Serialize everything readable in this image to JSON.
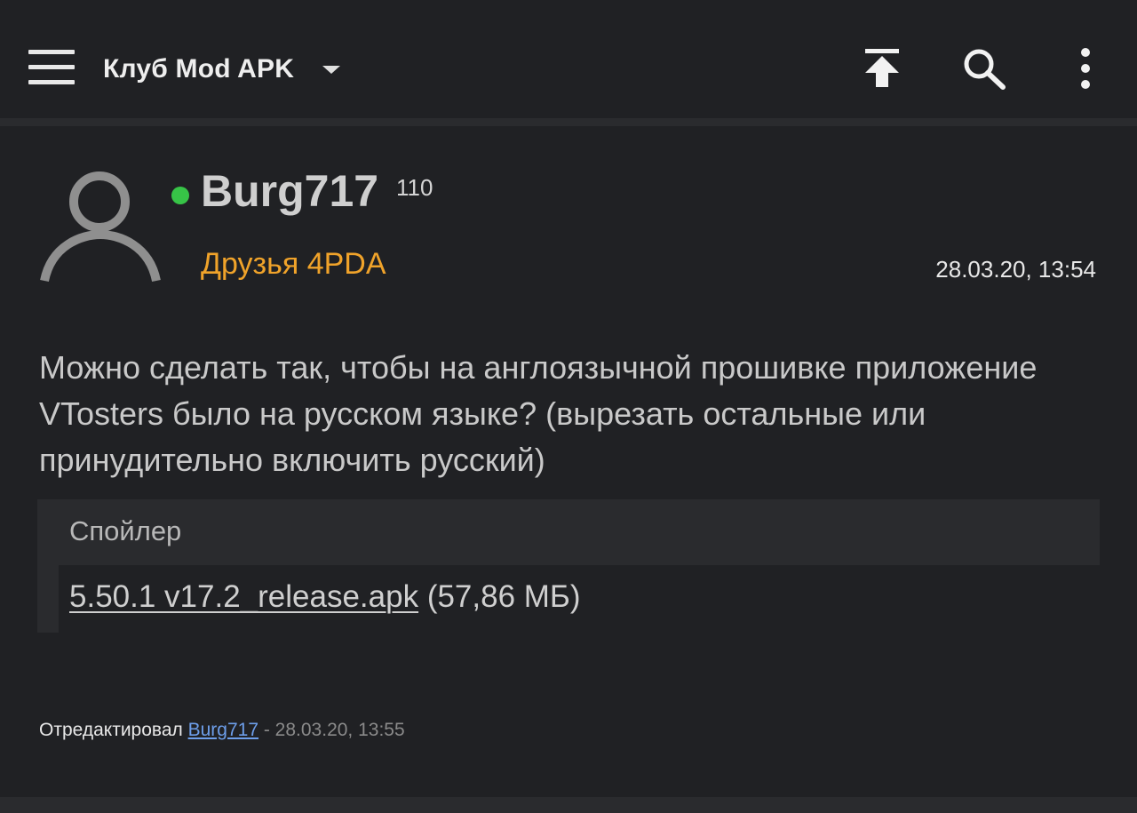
{
  "header": {
    "title": "Клуб Mod APK",
    "icons": [
      "menu-icon",
      "chevron-down-icon",
      "scroll-top-icon",
      "search-icon",
      "more-vert-icon"
    ]
  },
  "post": {
    "author": {
      "name": "Burg717",
      "reputation": "110",
      "group": "Друзья 4PDA",
      "online": true
    },
    "date": "28.03.20, 13:54",
    "body": "Можно сделать так, чтобы на англоязычной прошивке приложение VTosters было на русском языке? (вырезать остальные или принудительно включить русский)",
    "spoiler": {
      "title": "Спойлер",
      "attachment_name": "5.50.1 v17.2_release.apk",
      "attachment_size": "(57,86 МБ)"
    },
    "edited": {
      "label": "Отредактировал",
      "user": "Burg717",
      "date": "- 28.03.20, 13:55"
    }
  },
  "colors": {
    "background": "#202124",
    "panel": "#2a2b2e",
    "group_color": "#f0a32a",
    "online_color": "#37c447",
    "link_color": "#6d9eea"
  }
}
